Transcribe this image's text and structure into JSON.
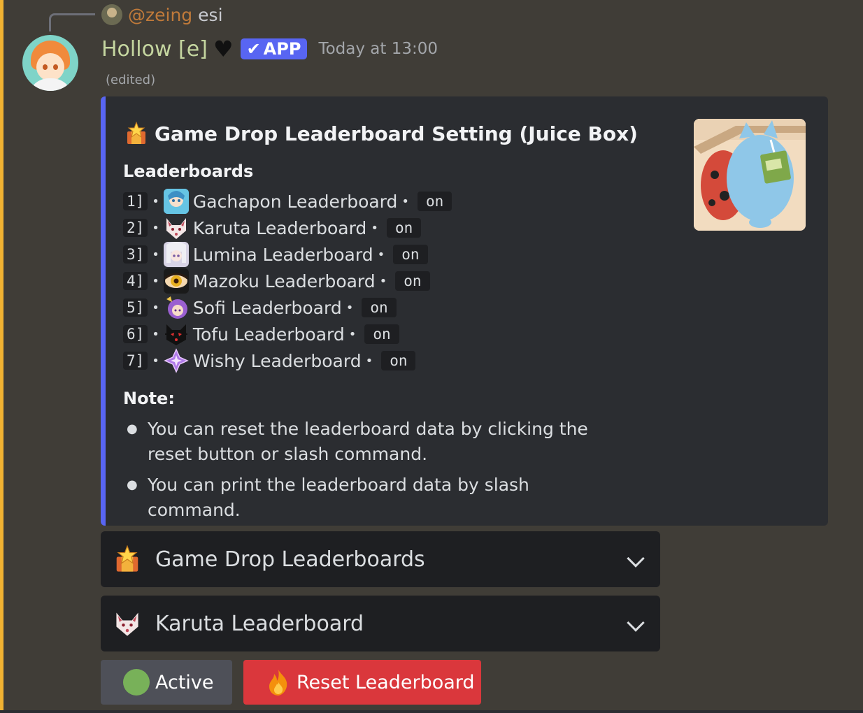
{
  "reply": {
    "mention": "@zeing",
    "text": "esi"
  },
  "message": {
    "username": "Hollow [e]",
    "badge": "APP",
    "badge_check": "✔",
    "timestamp": "Today at 13:00",
    "edited": "(edited)"
  },
  "embed": {
    "accent_color": "#5865f2",
    "title": "Game Drop Leaderboard Setting (Juice Box)",
    "field_name": "Leaderboards",
    "leaderboards": [
      {
        "index": "1]",
        "name": "Gachapon Leaderboard",
        "status": "on",
        "icon": "gachapon-icon"
      },
      {
        "index": "2]",
        "name": "Karuta Leaderboard",
        "status": "on",
        "icon": "karuta-icon"
      },
      {
        "index": "3]",
        "name": "Lumina Leaderboard",
        "status": "on",
        "icon": "lumina-icon"
      },
      {
        "index": "4]",
        "name": "Mazoku Leaderboard",
        "status": "on",
        "icon": "mazoku-icon"
      },
      {
        "index": "5]",
        "name": "Sofi Leaderboard",
        "status": "on",
        "icon": "sofi-icon"
      },
      {
        "index": "6]",
        "name": "Tofu Leaderboard",
        "status": "on",
        "icon": "tofu-icon"
      },
      {
        "index": "7]",
        "name": "Wishy Leaderboard",
        "status": "on",
        "icon": "wishy-icon"
      }
    ],
    "note_title": "Note:",
    "notes": [
      "You can reset the leaderboard data by clicking the reset button or slash command.",
      "You can print the leaderboard data by slash command."
    ]
  },
  "selects": {
    "game_drop": "Game Drop Leaderboards",
    "karuta": "Karuta Leaderboard"
  },
  "buttons": {
    "active": "Active",
    "reset": "Reset Leaderboard"
  }
}
